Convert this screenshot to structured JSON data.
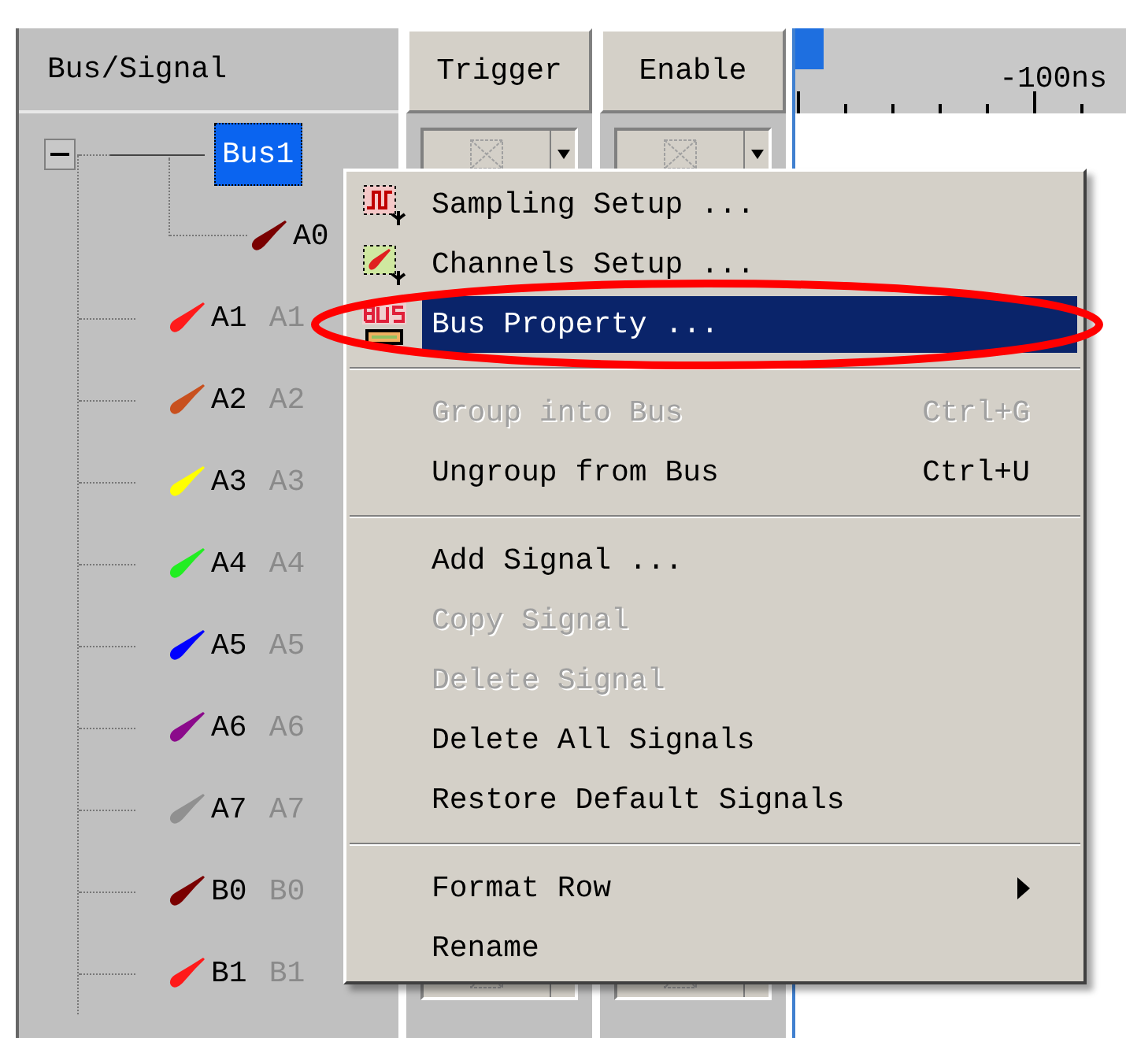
{
  "columns": [
    {
      "label": "Bus/Signal"
    },
    {
      "label": "Trigger"
    },
    {
      "label": "Enable"
    }
  ],
  "timeline": {
    "tick_label": "-100ns"
  },
  "signals": [
    {
      "name": "Bus1",
      "kind": "bus",
      "selected": true,
      "expanded": true,
      "children": [
        {
          "name": "A0",
          "kind": "signal",
          "selected": false,
          "color": "#7a0000"
        }
      ]
    },
    {
      "name": "A1",
      "alias": "A1",
      "kind": "signal",
      "selected": false,
      "color": "#ff1a1a"
    },
    {
      "name": "A2",
      "alias": "A2",
      "kind": "signal",
      "selected": false,
      "color": "#c8501e"
    },
    {
      "name": "A3",
      "alias": "A3",
      "kind": "signal",
      "selected": false,
      "color": "#ffff00"
    },
    {
      "name": "A4",
      "alias": "A4",
      "kind": "signal",
      "selected": false,
      "color": "#22ee22"
    },
    {
      "name": "A5",
      "alias": "A5",
      "kind": "signal",
      "selected": false,
      "color": "#0000ff"
    },
    {
      "name": "A6",
      "alias": "A6",
      "kind": "signal",
      "selected": false,
      "color": "#8b0a8b"
    },
    {
      "name": "A7",
      "alias": "A7",
      "kind": "signal",
      "selected": false,
      "color": "#909090"
    },
    {
      "name": "B0",
      "alias": "B0",
      "kind": "signal",
      "selected": false,
      "color": "#7a0000"
    },
    {
      "name": "B1",
      "alias": "B1",
      "kind": "signal",
      "selected": false,
      "color": "#ff1a1a"
    }
  ],
  "context_menu": [
    {
      "kind": "item",
      "label": "Sampling Setup ...",
      "disabled": false,
      "selected": false
    },
    {
      "kind": "item",
      "label": "Channels Setup ...",
      "disabled": false,
      "selected": false
    },
    {
      "kind": "item",
      "label": "Bus Property ...",
      "disabled": false,
      "selected": true
    },
    {
      "kind": "separator"
    },
    {
      "kind": "item",
      "label": "Group into Bus",
      "shortcut": "Ctrl+G",
      "disabled": true,
      "selected": false
    },
    {
      "kind": "item",
      "label": "Ungroup from Bus",
      "shortcut": "Ctrl+U",
      "disabled": false,
      "selected": false
    },
    {
      "kind": "separator"
    },
    {
      "kind": "item",
      "label": "Add Signal ...",
      "disabled": false,
      "selected": false
    },
    {
      "kind": "item",
      "label": "Copy Signal",
      "disabled": true,
      "selected": false
    },
    {
      "kind": "item",
      "label": "Delete Signal",
      "disabled": true,
      "selected": false
    },
    {
      "kind": "item",
      "label": "Delete All Signals",
      "disabled": false,
      "selected": false
    },
    {
      "kind": "item",
      "label": "Restore Default Signals",
      "disabled": false,
      "selected": false
    },
    {
      "kind": "separator"
    },
    {
      "kind": "item",
      "label": "Format Row",
      "disabled": false,
      "selected": false,
      "submenu": true
    },
    {
      "kind": "item",
      "label": "Rename",
      "disabled": false,
      "selected": false
    }
  ]
}
